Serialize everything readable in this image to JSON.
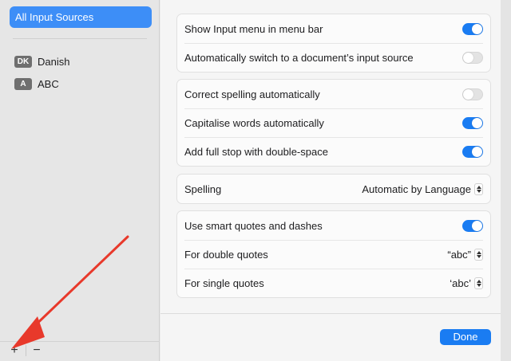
{
  "sidebar": {
    "selected_item": "All Input Sources",
    "sources": [
      {
        "badge": "DK",
        "label": "Danish"
      },
      {
        "badge": "A",
        "label": "ABC"
      }
    ],
    "add_label": "+",
    "remove_label": "−"
  },
  "groups": {
    "menu": {
      "show_input_menu": {
        "label": "Show Input menu in menu bar",
        "on": true
      },
      "auto_switch": {
        "label": "Automatically switch to a document’s input source",
        "on": false
      }
    },
    "text": {
      "correct_spelling": {
        "label": "Correct spelling automatically",
        "on": false
      },
      "capitalise": {
        "label": "Capitalise words automatically",
        "on": true
      },
      "full_stop": {
        "label": "Add full stop with double-space",
        "on": true
      }
    },
    "spelling": {
      "label": "Spelling",
      "value": "Automatic by Language"
    },
    "quotes": {
      "smart_quotes": {
        "label": "Use smart quotes and dashes",
        "on": true
      },
      "double_quotes": {
        "label": "For double quotes",
        "value": "“abc”"
      },
      "single_quotes": {
        "label": "For single quotes",
        "value": "‘abc’"
      }
    }
  },
  "footer": {
    "done_label": "Done"
  },
  "colors": {
    "accent": "#1a7cf2",
    "selection": "#3d8ef7",
    "annotation_arrow": "#e8392b"
  },
  "icons": {
    "add": "plus-icon",
    "remove": "minus-icon",
    "stepper": "up-down-chevron-icon",
    "annotation": "red-arrow-icon"
  }
}
